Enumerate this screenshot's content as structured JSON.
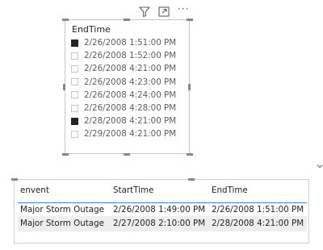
{
  "slicer": {
    "title": "EndTime",
    "header_icons": [
      "filter-icon",
      "focus-mode-icon",
      "more-options-icon"
    ],
    "more_options_label": "···",
    "items": [
      {
        "label": "2/26/2008 1:51:00 PM",
        "checked": true
      },
      {
        "label": "2/26/2008 1:52:00 PM",
        "checked": false
      },
      {
        "label": "2/26/2008 4:21:00 PM",
        "checked": false
      },
      {
        "label": "2/26/2008 4:23:00 PM",
        "checked": false
      },
      {
        "label": "2/26/2008 4:24:00 PM",
        "checked": false
      },
      {
        "label": "2/26/2008 4:28:00 PM",
        "checked": false
      },
      {
        "label": "2/28/2008 4:21:00 PM",
        "checked": true
      },
      {
        "label": "2/29/2008 4:21:00 PM",
        "checked": false
      }
    ]
  },
  "table": {
    "columns": [
      "envent",
      "StartTime",
      "EndTime"
    ],
    "rows": [
      [
        "Major Storm Outage",
        "2/26/2008 1:49:00 PM",
        "2/26/2008 1:51:00 PM"
      ],
      [
        "Major Storm Outage",
        "2/27/2008 2:10:00 PM",
        "2/28/2008 4:21:00 PM"
      ]
    ]
  },
  "colors": {
    "accent": "#118dff",
    "checked": "#252423",
    "alt_row": "#efeeed",
    "handle": "#8a8886"
  }
}
